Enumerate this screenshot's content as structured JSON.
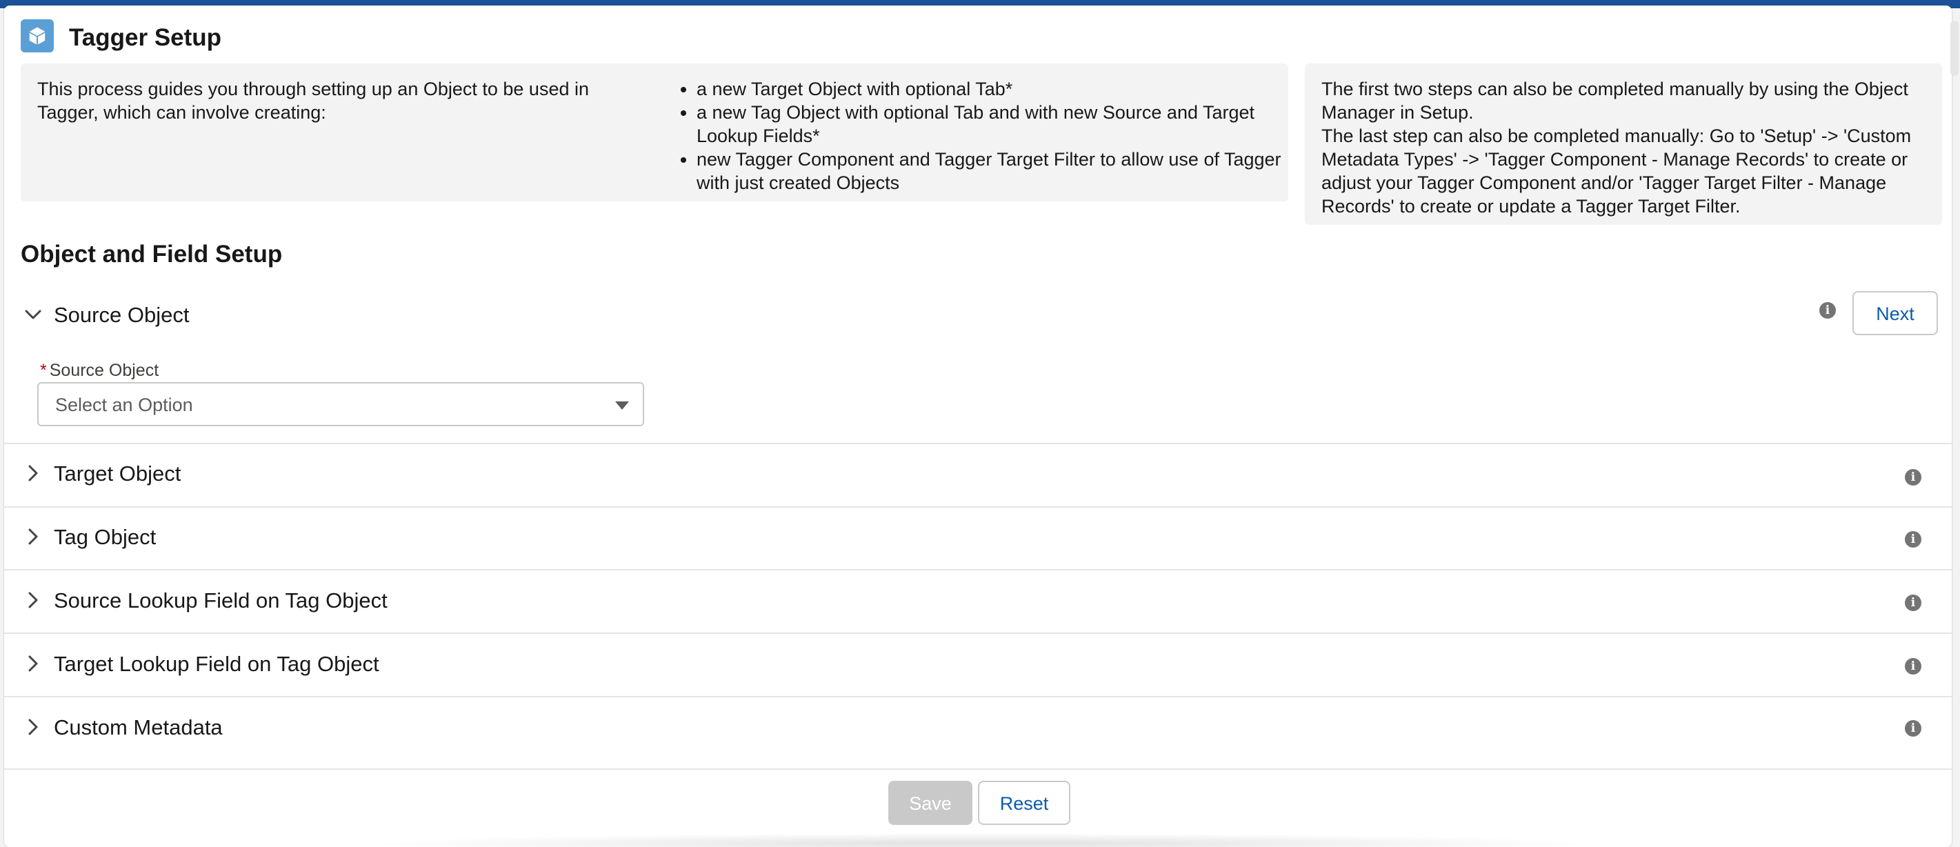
{
  "header": {
    "title": "Tagger Setup",
    "icon": "cube-icon",
    "icon_color": "#5a9fd6"
  },
  "info": {
    "description": "This process guides you through setting up an Object to be used in Tagger, which can involve creating:",
    "items": [
      "a new Target Object with optional Tab*",
      "a new Tag Object with optional Tab and with new Source and Target Lookup Fields*",
      "new Tagger Component and Tagger Target Filter to allow use of Tagger with just created Objects"
    ],
    "manual_note_1": "The first two steps can also be completed manually by using the Object Manager in Setup.",
    "manual_note_2": "The last step can also be completed manually: Go to 'Setup' -> 'Custom Metadata Types' -> 'Tagger Component - Manage Records' to create or adjust your Tagger Component and/or 'Tagger Target Filter - Manage Records' to create or update a Tagger Target Filter."
  },
  "section": {
    "title": "Object and Field Setup"
  },
  "accordion": {
    "source": {
      "title": "Source Object",
      "expanded": true,
      "next_label": "Next",
      "field_label": "Source Object",
      "required_marker": "*",
      "placeholder": "Select an Option"
    },
    "collapsed": [
      "Target Object",
      "Tag Object",
      "Source Lookup Field on Tag Object",
      "Target Lookup Field on Tag Object",
      "Custom Metadata"
    ]
  },
  "footer": {
    "save_label": "Save",
    "save_disabled": true,
    "reset_label": "Reset"
  },
  "colors": {
    "accent": "#0b5cab",
    "top_bar": "#1b5297",
    "required": "#ba0517"
  }
}
